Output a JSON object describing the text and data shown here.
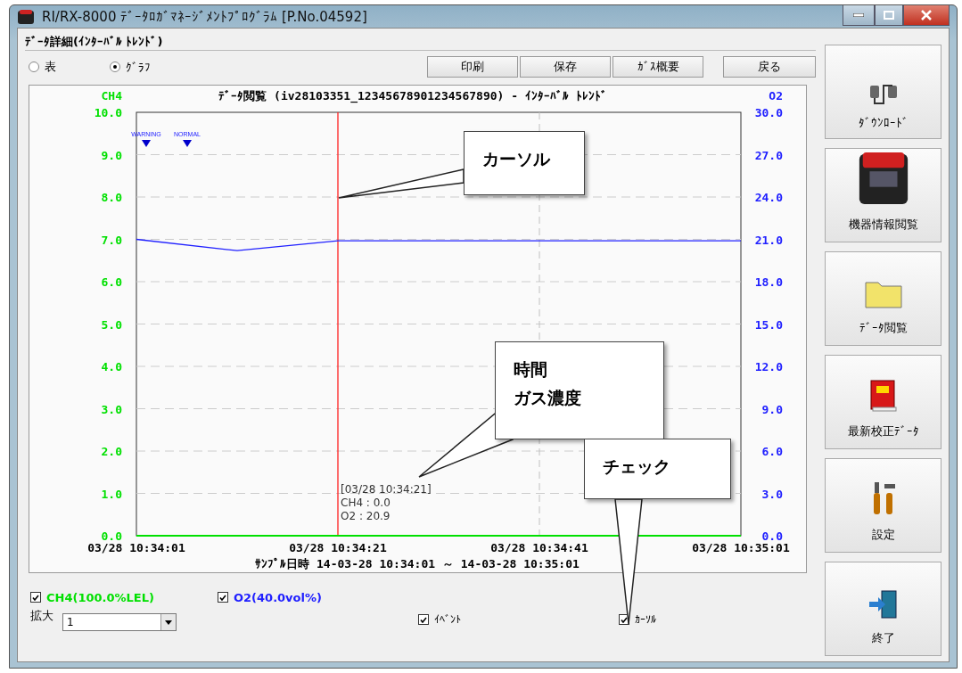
{
  "window": {
    "title": "RI/RX-8000 ﾃﾞｰﾀﾛｶﾞﾏﾈｰｼﾞﾒﾝﾄﾌﾟﾛｸﾞﾗﾑ [P.No.04592]"
  },
  "panel": {
    "title": "ﾃﾞｰﾀ詳細(ｲﾝﾀｰﾊﾞﾙ ﾄﾚﾝﾄﾞ)",
    "view_options": [
      {
        "label": "表",
        "selected": false
      },
      {
        "label": "ｸﾞﾗﾌ",
        "selected": true
      }
    ],
    "buttons": [
      {
        "label": "印刷"
      },
      {
        "label": "保存"
      },
      {
        "label": "ｶﾞｽ概要"
      },
      {
        "label": "戻る"
      }
    ],
    "chart": {
      "left_axis_ticks": [
        "10.0",
        "9.0",
        "8.0",
        "7.0",
        "6.0",
        "5.0",
        "4.0",
        "3.0",
        "2.0",
        "1.0",
        "0.0"
      ],
      "cursor_readout": [
        "[03/28 10:34:21]",
        "CH4 : 0.0",
        "O2 : 20.9"
      ],
      "chart_data": {
        "type": "line",
        "title": "ﾃﾞｰﾀ閲覧 (iv28103351_12345678901234567890) - ｲﾝﾀｰﾊﾞﾙ ﾄﾚﾝﾄﾞ",
        "xlabel": "ｻﾝﾌﾟﾙ日時 14-03-28 10:34:01 ～ 14-03-28 10:35:01",
        "categories": [
          "03/28 10:34:01",
          null,
          "03/28 10:34:21",
          null,
          "03/28 10:34:41",
          null,
          "03/28 10:35:01"
        ],
        "series": [
          {
            "name": "CH4",
            "color": "#00e000",
            "values": [
              0,
              0,
              0,
              0,
              0,
              0,
              0
            ]
          },
          {
            "name": "O2",
            "color": "#2020ff",
            "values": [
              21.0,
              20.2,
              20.9,
              20.9,
              20.9,
              20.9,
              20.9
            ]
          }
        ],
        "ylim": [
          0,
          30
        ],
        "yticks": [
          {
            "value": 0,
            "label": "0.0"
          },
          {
            "value": 3,
            "label": "3.0"
          },
          {
            "value": 6,
            "label": "6.0"
          },
          {
            "value": 9,
            "label": "9.0"
          },
          {
            "value": 12,
            "label": "12.0"
          },
          {
            "value": 15,
            "label": "15.0"
          },
          {
            "value": 18,
            "label": "18.0"
          },
          {
            "value": 21,
            "label": "21.0"
          },
          {
            "value": 24,
            "label": "24.0"
          },
          {
            "value": 27,
            "label": "27.0"
          },
          {
            "value": 30,
            "label": "30.0"
          }
        ],
        "grid": true,
        "annotations": [
          {
            "text": "WARNING"
          },
          {
            "text": "NORMAL"
          }
        ],
        "ref_lines": [
          {
            "axis": "x",
            "value": "03/28 10:34:21",
            "color": "#ff2020"
          },
          {
            "axis": "x",
            "value": "03/28 10:34:41",
            "color": "#c0c0c0"
          }
        ]
      }
    },
    "series_toggles": [
      {
        "label": "CH4(100.0%LEL)",
        "checked": true,
        "color": "#00e000"
      },
      {
        "label": "O2(40.0vol%)",
        "checked": true,
        "color": "#2020ff"
      }
    ],
    "zoom": {
      "label": "拡大",
      "value": "1"
    },
    "options": [
      {
        "label": "ｲﾍﾞﾝﾄ",
        "checked": true
      },
      {
        "label": "ｶｰｿﾙ",
        "checked": true
      }
    ]
  },
  "sidebar": [
    {
      "kind": "download",
      "label": "ﾀﾞｳﾝﾛｰﾄﾞ"
    },
    {
      "kind": "device",
      "label": "機器情報閲覧"
    },
    {
      "kind": "folder",
      "label": "ﾃﾞｰﾀ閲覧"
    },
    {
      "kind": "book",
      "label": "最新校正ﾃﾞｰﾀ"
    },
    {
      "kind": "tools",
      "label": "設定"
    },
    {
      "kind": "exit",
      "label": "終了"
    }
  ],
  "callouts": [
    {
      "lines": [
        "カーソル"
      ]
    },
    {
      "lines": [
        "時間",
        "ガス濃度"
      ]
    },
    {
      "lines": [
        "チェック"
      ]
    }
  ]
}
